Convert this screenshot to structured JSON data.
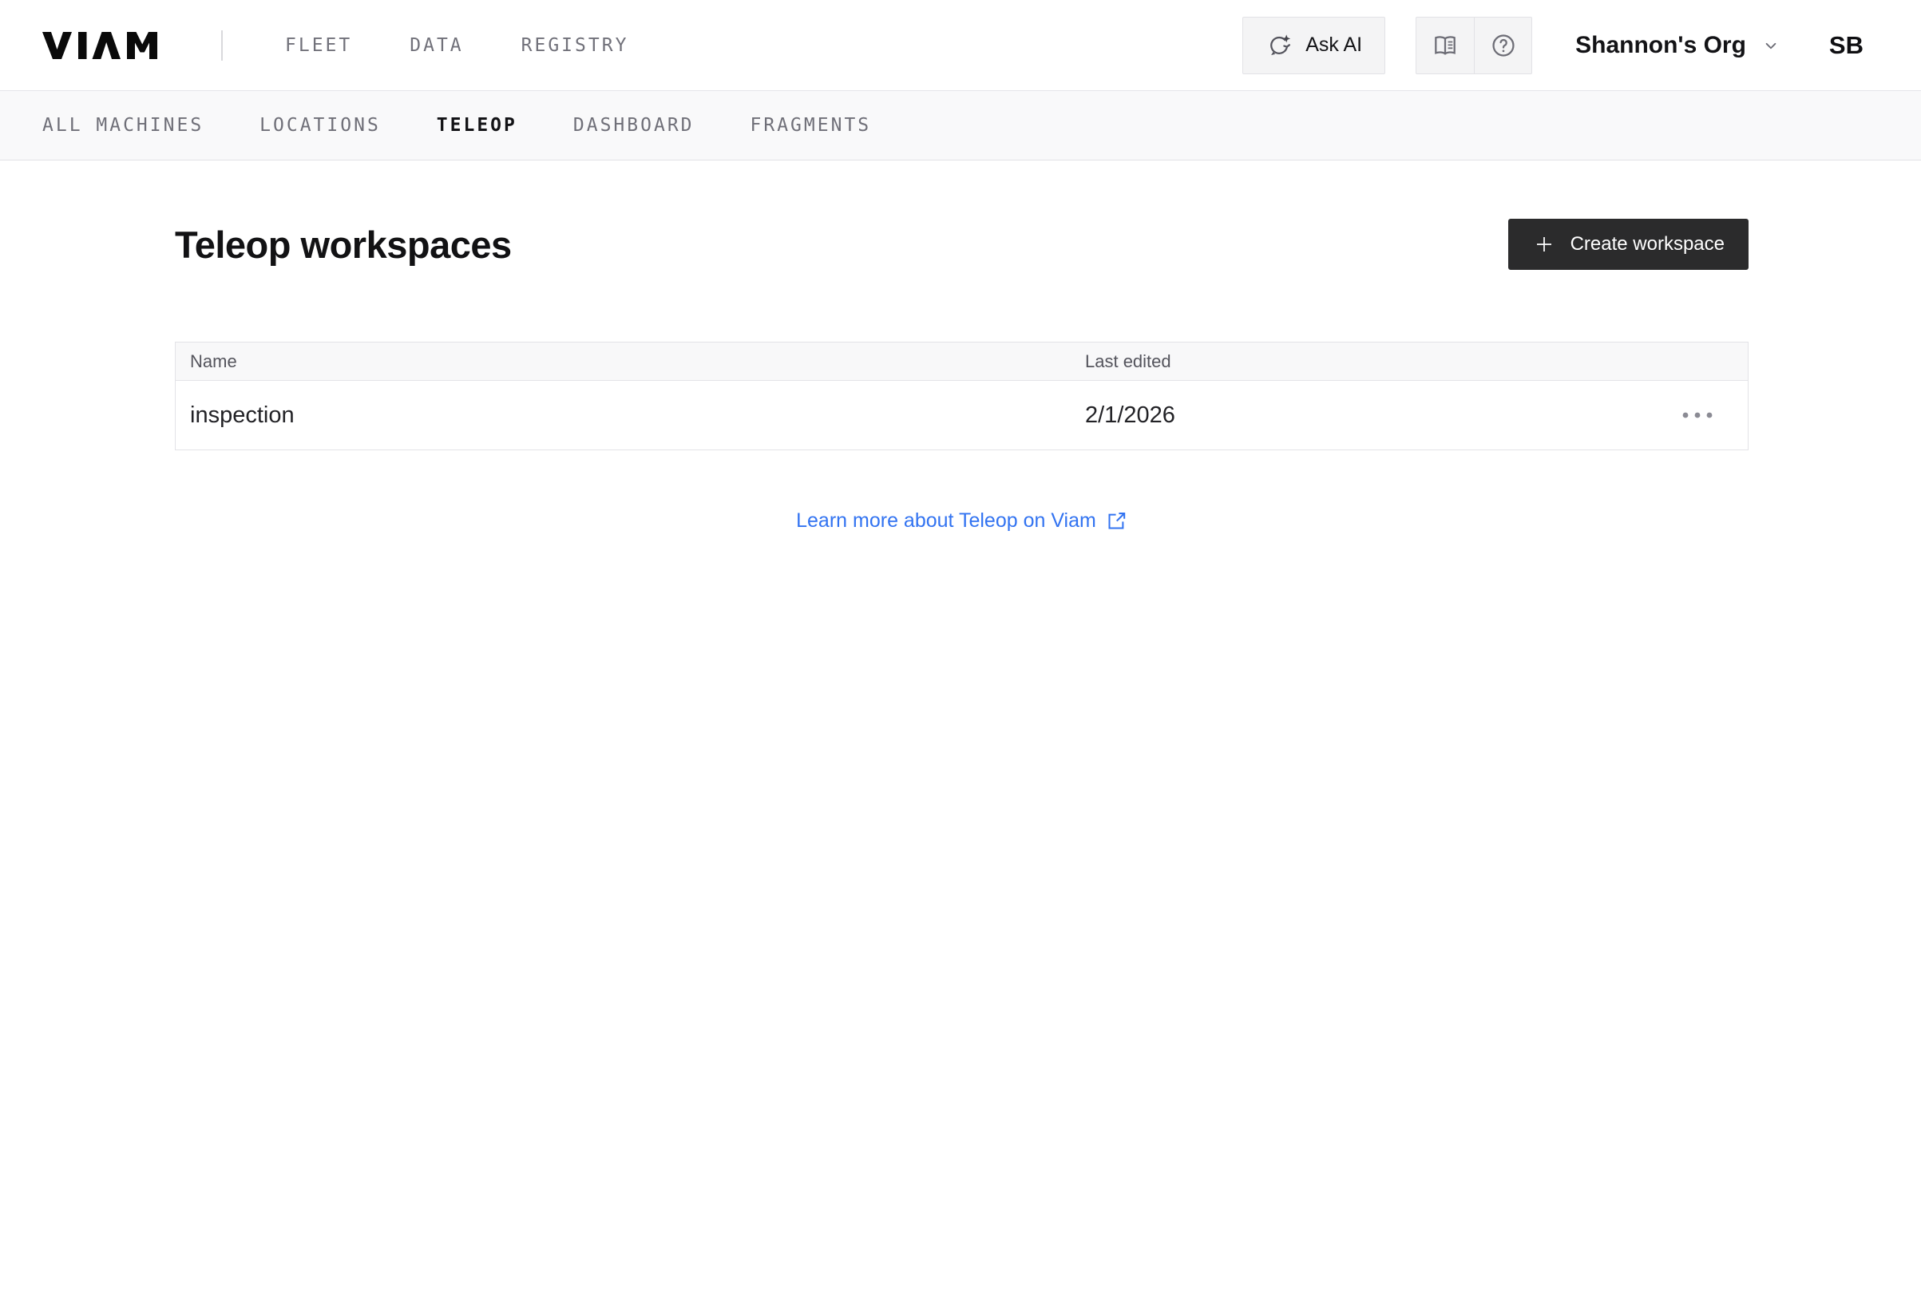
{
  "header": {
    "logo_text": "VIAM",
    "nav": [
      {
        "label": "FLEET"
      },
      {
        "label": "DATA"
      },
      {
        "label": "REGISTRY"
      }
    ],
    "ask_ai_label": "Ask AI",
    "org_name": "Shannon's Org",
    "avatar_initials": "SB",
    "icons": {
      "ask_ai": "sparkle-refresh-icon",
      "docs": "open-book-icon",
      "help": "question-circle-icon",
      "org": "chevron-down-icon"
    }
  },
  "tabs": [
    {
      "label": "ALL MACHINES",
      "active": false
    },
    {
      "label": "LOCATIONS",
      "active": false
    },
    {
      "label": "TELEOP",
      "active": true
    },
    {
      "label": "DASHBOARD",
      "active": false
    },
    {
      "label": "FRAGMENTS",
      "active": false
    }
  ],
  "main": {
    "title": "Teleop workspaces",
    "create_button_label": "Create workspace",
    "table": {
      "columns": [
        "Name",
        "Last edited"
      ],
      "rows": [
        {
          "name": "inspection",
          "last_edited": "2/1/2026"
        }
      ],
      "row_menu_icon": "ellipsis-icon"
    },
    "learn_more_label": "Learn more about Teleop on Viam",
    "learn_more_icon": "external-link-icon"
  },
  "colors": {
    "accent_blue": "#3273f1",
    "dark_button_bg": "#2b2b2c",
    "band_bg": "#f9f9fa",
    "border": "#e3e3e7",
    "nav_gray": "#71717a",
    "active_tab": "#131316"
  }
}
